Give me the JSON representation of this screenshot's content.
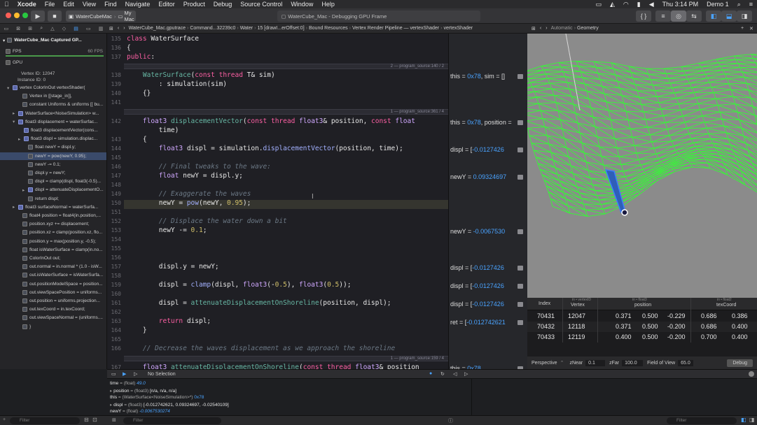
{
  "menubar": {
    "app": "Xcode",
    "items": [
      "File",
      "Edit",
      "View",
      "Find",
      "Navigate",
      "Editor",
      "Product",
      "Debug",
      "Source Control",
      "Window",
      "Help"
    ],
    "clock": "Thu 3:14 PM",
    "user": "Demo 1"
  },
  "toolbar": {
    "scheme": "WaterCubeMac",
    "destination": "My Mac",
    "status": "WaterCube_Mac - Debugging GPU Frame"
  },
  "jumpbar": {
    "crumbs": [
      "WaterCube_Mac.gputrace",
      "Command...32239c0",
      "Water",
      "15 [drawI...erOffset:0]",
      "Bound Resources",
      "Vertex Render Pipeline — vertexShader",
      "vertexShader"
    ],
    "right_crumbs": [
      "Automatic",
      "Geometry"
    ]
  },
  "navigator": {
    "header": "WaterCube_Mac Captured GP...",
    "fps_label": "FPS",
    "fps_value": "60 FPS",
    "gpu_label": "GPU",
    "vertex_id": "Vertex ID:  12047",
    "instance_id": "Instance ID:  0",
    "rows": [
      "vertex ColorInOut vertexShader(",
      "Vertex in [[stage_in]],",
      "constant Uniforms & uniforms [[ bu...",
      "WaterSurface<NoiseSimulation> w...",
      "float3 displacement = waterSurfac...",
      "float3 displacementVector(cons...",
      "float3 displ = simulation.displac...",
      "float newY = displ.y;",
      "newY = pow(newY, 0.95);",
      "newY -= 0.1;",
      "displ.y = newY;",
      "displ = clamp(displ, float3(-0.5)...",
      "displ = attenuateDisplacementO...",
      "return displ;",
      "float3 surfaceNormal = waterSurfa...",
      "float4 position = float4(in.position,...",
      "position.xyz += displacement;",
      "position.xz = clamp(position.xz, flo...",
      "position.y = max(position.y, -0.5);",
      "float isWaterSurface = clamp(in.no...",
      "ColorInOut out;",
      "out.normal = in.normal * (1.0 - isW...",
      "out.isWaterSurface = isWaterSurfa...",
      "out.positionModelSpace = position...",
      "out.viewSpacePosition = uniforms...",
      "out.position = uniforms.projection...",
      "out.texCoord = in.texCoord;",
      "out.viewSpaceNormal = (uniforms....",
      "}"
    ],
    "filter_placeholder": "Filter"
  },
  "editor": {
    "separators": [
      "2 — program_source:140",
      "1 — program_source:361",
      "1 — program_source:159"
    ],
    "sep_counts": [
      "/ 2",
      "/ 4",
      "/ 4"
    ],
    "line_numbers": [
      "135",
      "136",
      "137",
      "138",
      "139",
      "140",
      "141",
      "142",
      "",
      "143",
      "144",
      "145",
      "146",
      "147",
      "148",
      "149",
      "150",
      "151",
      "152",
      "153",
      "154",
      "155",
      "156",
      "157",
      "158",
      "159",
      "160",
      "161",
      "162",
      "163",
      "164",
      "165",
      "166",
      "167"
    ]
  },
  "values": {
    "rows": [
      {
        "prefix": "this = ",
        "num": "0x78",
        "suffix": ", sim = []"
      },
      {
        "prefix": "this = ",
        "num": "0x78",
        "suffix": ", position ="
      },
      {
        "prefix": "displ = [",
        "num": "-0.0127426",
        "suffix": ""
      },
      {
        "prefix": "newY = ",
        "num": "0.09324697",
        "suffix": ""
      },
      {
        "prefix": "newY = ",
        "num": "-0.0067530",
        "suffix": ""
      },
      {
        "prefix": "displ = [",
        "num": "-0.0127426",
        "suffix": ""
      },
      {
        "prefix": "displ = [",
        "num": "-0.0127426",
        "suffix": ""
      },
      {
        "prefix": "displ = [",
        "num": "-0.0127426",
        "suffix": ""
      },
      {
        "prefix": "ret = [",
        "num": "-0.012742621",
        "suffix": ""
      },
      {
        "prefix": "this = ",
        "num": "0x78",
        "suffix": ""
      }
    ]
  },
  "geometry_table": {
    "headers": {
      "index": "Index",
      "vertex_small": "in • vertexID",
      "vertex": "Vertex",
      "position_small": "in • float3",
      "position": "position",
      "texcoord_small": "in • float2",
      "texcoord": "texCoord"
    },
    "rows": [
      [
        "70431",
        "12047",
        "0.371",
        "0.500",
        "-0.229",
        "0.686",
        "0.386"
      ],
      [
        "70432",
        "12118",
        "0.371",
        "0.500",
        "-0.200",
        "0.686",
        "0.400"
      ],
      [
        "70433",
        "12119",
        "0.400",
        "0.500",
        "-0.200",
        "0.700",
        "0.400"
      ]
    ]
  },
  "geometry_controls": {
    "projection": "Perspective",
    "znear_label": "zNear",
    "znear": "0.1",
    "zfar_label": "zFar",
    "zfar": "100.0",
    "fov_label": "Field of View",
    "fov": "65.0",
    "debug": "Debug"
  },
  "debugbar": {
    "selection": "No Selection"
  },
  "variables": [
    {
      "name": "time",
      "type": " = (float) ",
      "value": "49.0"
    },
    {
      "name": "position",
      "type": " = (float3) ",
      "value": "[n/a, n/a, n/a]"
    },
    {
      "name": "this",
      "type": " = (WaterSurface<NoiseSimulation>*) ",
      "value": "0x78"
    },
    {
      "name": "displ",
      "type": " = (float3) ",
      "value": "[-0.012742621, 0.09324697, -0.02540109]"
    },
    {
      "name": "newY",
      "type": " = (float) ",
      "value": "-0.0067530274"
    }
  ],
  "bottom": {
    "filter_placeholder": "Filter",
    "output_label": "All Output"
  }
}
